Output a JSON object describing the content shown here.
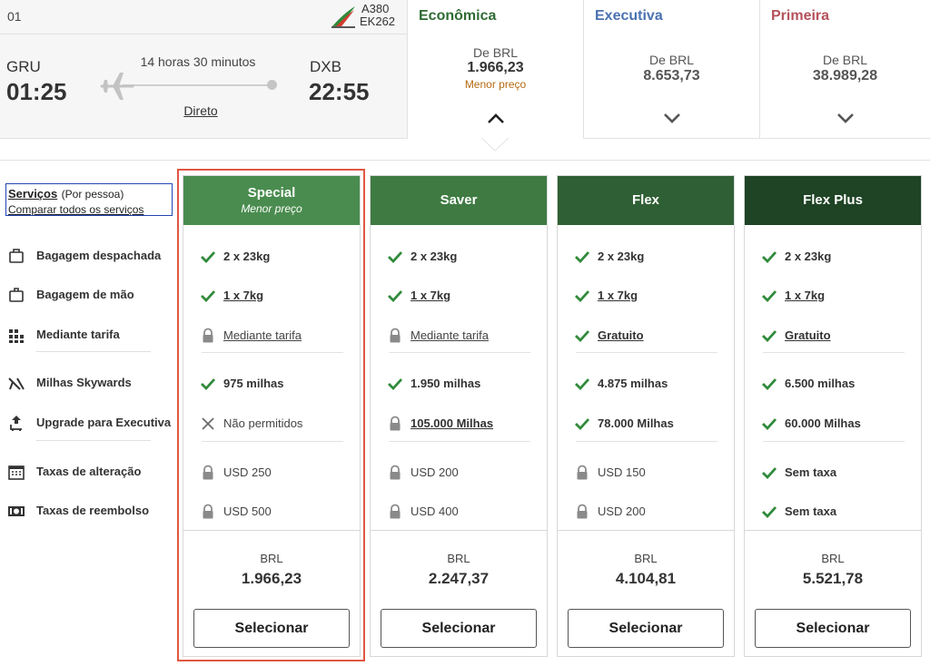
{
  "flight": {
    "number": "01",
    "aircraft": "A380",
    "flight_code": "EK262",
    "origin": "GRU",
    "departure": "01:25",
    "destination": "DXB",
    "arrival": "22:55",
    "duration": "14 horas 30 minutos",
    "stops": "Direto"
  },
  "cabins": [
    {
      "name": "Econômica",
      "from": "De BRL",
      "price": "1.966,23",
      "note": "Menor preço",
      "color": "#2f6b33",
      "active": true
    },
    {
      "name": "Executiva",
      "from": "De BRL",
      "price": "8.653,73",
      "note": "",
      "color": "#4b72b2",
      "active": false
    },
    {
      "name": "Primeira",
      "from": "De BRL",
      "price": "38.989,28",
      "note": "",
      "color": "#b5525a",
      "active": false
    }
  ],
  "services": {
    "title": "Serviços",
    "subtitle": "(Por pessoa)",
    "compare_link": "Comparar todos os serviços",
    "rows": [
      {
        "label": "Bagagem despachada",
        "icon": "suitcase-icon"
      },
      {
        "label": "Bagagem de mão",
        "icon": "carry-on-icon"
      },
      {
        "label": "Mediante tarifa",
        "icon": "seat-map-icon"
      },
      {
        "label": "Milhas Skywards",
        "icon": "skywards-icon"
      },
      {
        "label": "Upgrade para Executiva",
        "icon": "upgrade-seat-icon"
      },
      {
        "label": "Taxas de alteração",
        "icon": "calendar-icon"
      },
      {
        "label": "Taxas de reembolso",
        "icon": "money-icon"
      }
    ]
  },
  "fares": [
    {
      "name": "Special",
      "sub": "Menor preço",
      "color": "#4a8c4f",
      "cells": [
        {
          "icon": "check",
          "text": "2 x 23kg",
          "style": "bold"
        },
        {
          "icon": "check",
          "text": "1 x 7kg",
          "style": "bold link"
        },
        {
          "icon": "lock",
          "text": "Mediante tarifa",
          "style": "plain link"
        },
        {
          "icon": "check",
          "text": "975 milhas",
          "style": "bold"
        },
        {
          "icon": "cross",
          "text": "Não permitidos",
          "style": "plain"
        },
        {
          "icon": "lock",
          "text": "USD 250",
          "style": "plain"
        },
        {
          "icon": "lock",
          "text": "USD 500",
          "style": "plain"
        }
      ],
      "currency": "BRL",
      "price": "1.966,23",
      "button": "Selecionar"
    },
    {
      "name": "Saver",
      "sub": "",
      "color": "#3e7a42",
      "cells": [
        {
          "icon": "check",
          "text": "2 x 23kg",
          "style": "bold"
        },
        {
          "icon": "check",
          "text": "1 x 7kg",
          "style": "bold link"
        },
        {
          "icon": "lock",
          "text": "Mediante tarifa",
          "style": "plain link"
        },
        {
          "icon": "check",
          "text": "1.950 milhas",
          "style": "bold"
        },
        {
          "icon": "lock",
          "text": "105.000 Milhas",
          "style": "bold link"
        },
        {
          "icon": "lock",
          "text": "USD 200",
          "style": "plain"
        },
        {
          "icon": "lock",
          "text": "USD 400",
          "style": "plain"
        }
      ],
      "currency": "BRL",
      "price": "2.247,37",
      "button": "Selecionar"
    },
    {
      "name": "Flex",
      "sub": "",
      "color": "#2f5f34",
      "cells": [
        {
          "icon": "check",
          "text": "2 x 23kg",
          "style": "bold"
        },
        {
          "icon": "check",
          "text": "1 x 7kg",
          "style": "bold link"
        },
        {
          "icon": "check",
          "text": "Gratuito",
          "style": "bold link"
        },
        {
          "icon": "check",
          "text": "4.875 milhas",
          "style": "bold"
        },
        {
          "icon": "check",
          "text": "78.000 Milhas",
          "style": "bold"
        },
        {
          "icon": "lock",
          "text": "USD 150",
          "style": "plain"
        },
        {
          "icon": "lock",
          "text": "USD 200",
          "style": "plain"
        }
      ],
      "currency": "BRL",
      "price": "4.104,81",
      "button": "Selecionar"
    },
    {
      "name": "Flex Plus",
      "sub": "",
      "color": "#1f4325",
      "cells": [
        {
          "icon": "check",
          "text": "2 x 23kg",
          "style": "bold"
        },
        {
          "icon": "check",
          "text": "1 x 7kg",
          "style": "bold link"
        },
        {
          "icon": "check",
          "text": "Gratuito",
          "style": "bold link"
        },
        {
          "icon": "check",
          "text": "6.500 milhas",
          "style": "bold"
        },
        {
          "icon": "check",
          "text": "60.000 Milhas",
          "style": "bold"
        },
        {
          "icon": "check",
          "text": "Sem taxa",
          "style": "bold"
        },
        {
          "icon": "check",
          "text": "Sem taxa",
          "style": "bold"
        }
      ],
      "currency": "BRL",
      "price": "5.521,78",
      "button": "Selecionar"
    }
  ],
  "colors": {
    "check": "#2f8a3a",
    "lock": "#8a8a8a",
    "highlight": "#e05742"
  }
}
